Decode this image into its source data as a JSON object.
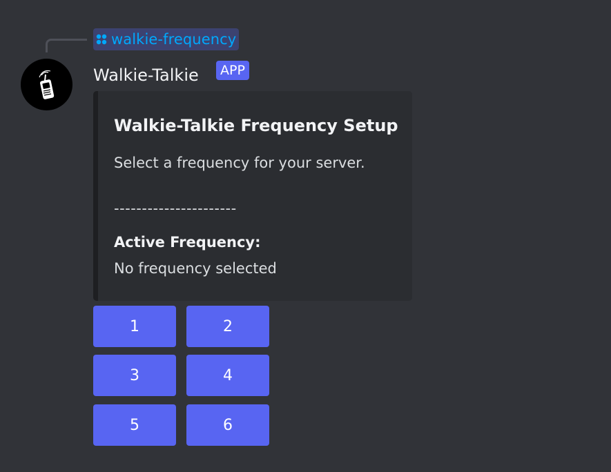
{
  "reply": {
    "command": "walkie-frequency",
    "icon": "slash-command-icon"
  },
  "message": {
    "author": "Walkie-Talkie",
    "badge": "APP",
    "avatar_icon": "walkie-talkie-icon"
  },
  "embed": {
    "title": "Walkie-Talkie Frequency Setup",
    "description": "Select a frequency for your server.",
    "divider": "----------------------",
    "field_name": "Active Frequency:",
    "field_value": "No frequency selected"
  },
  "buttons": [
    "1",
    "2",
    "3",
    "4",
    "5",
    "6"
  ],
  "colors": {
    "background": "#313338",
    "embed_background": "#2b2d31",
    "blurple": "#5865f2",
    "link": "#00a8fc"
  }
}
